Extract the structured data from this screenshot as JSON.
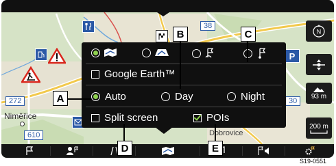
{
  "map": {
    "road_labels": [
      "38",
      "272",
      "610",
      "30"
    ],
    "place_name": "Nimĕřice",
    "place_name_2": "Dobrovice",
    "parking_label": "P"
  },
  "menu": {
    "map_mode_icons": [
      "map-2d-icon",
      "map-3d-icon",
      "destination-flag-icon",
      "terrain-flag-icon"
    ],
    "google_earth_label": "Google Earth™",
    "google_earth_checked": false,
    "mode_options": [
      {
        "label": "Auto",
        "selected": true
      },
      {
        "label": "Day",
        "selected": false
      },
      {
        "label": "Night",
        "selected": false
      }
    ],
    "split_screen_label": "Split screen",
    "split_screen_checked": false,
    "pois_label": "POIs",
    "pois_checked": true
  },
  "right_buttons": {
    "scale_1": "93 m",
    "scale_2": "200 m"
  },
  "callouts": [
    "A",
    "B",
    "C",
    "D",
    "E"
  ],
  "figure_code": "S19-0551",
  "colors": {
    "accent_green": "#8fd14f",
    "panel": "#101010",
    "road_blue": "#2f5ea8"
  }
}
